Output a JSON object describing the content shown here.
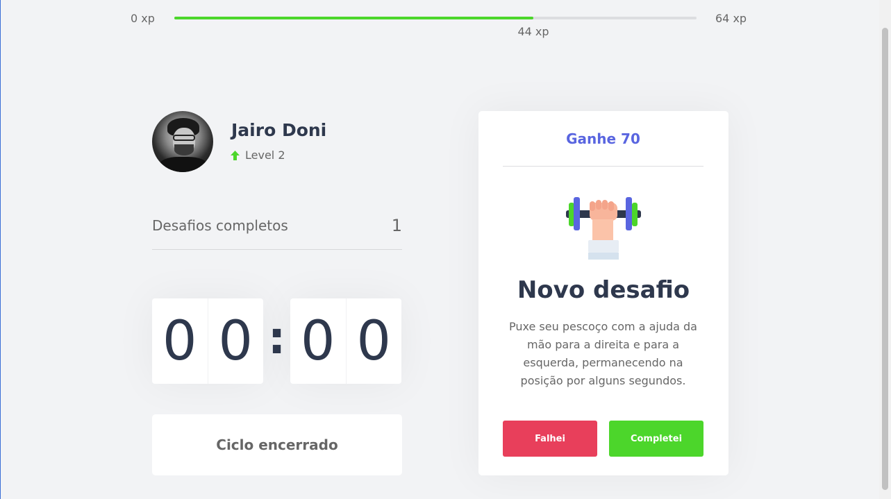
{
  "xp": {
    "min_label": "0 xp",
    "max_label": "64 xp",
    "current_label": "44 xp",
    "current": 44,
    "max": 64,
    "fill_color": "#4cd62b"
  },
  "profile": {
    "name": "Jairo Doni",
    "level_label": "Level 2",
    "level_icon": "level-up-arrow-icon"
  },
  "completed": {
    "label": "Desafios completos",
    "count": "1"
  },
  "countdown": {
    "minute_left": "0",
    "minute_right": "0",
    "separator": ":",
    "second_left": "0",
    "second_right": "0"
  },
  "cycle": {
    "button_label": "Ciclo encerrado"
  },
  "challenge": {
    "reward_label": "Ganhe 70",
    "icon": "body-dumbbell-icon",
    "title": "Novo desafio",
    "description": "Puxe seu pescoço com a ajuda da mão para a direita e para a esquerda, permanecendo na posição por alguns segundos.",
    "failed_label": "Falhei",
    "completed_label": "Completei"
  },
  "colors": {
    "accent_blue": "#5965e0",
    "danger_red": "#e83f5b",
    "success_green": "#4cd62b",
    "title_dark": "#2e384d"
  }
}
